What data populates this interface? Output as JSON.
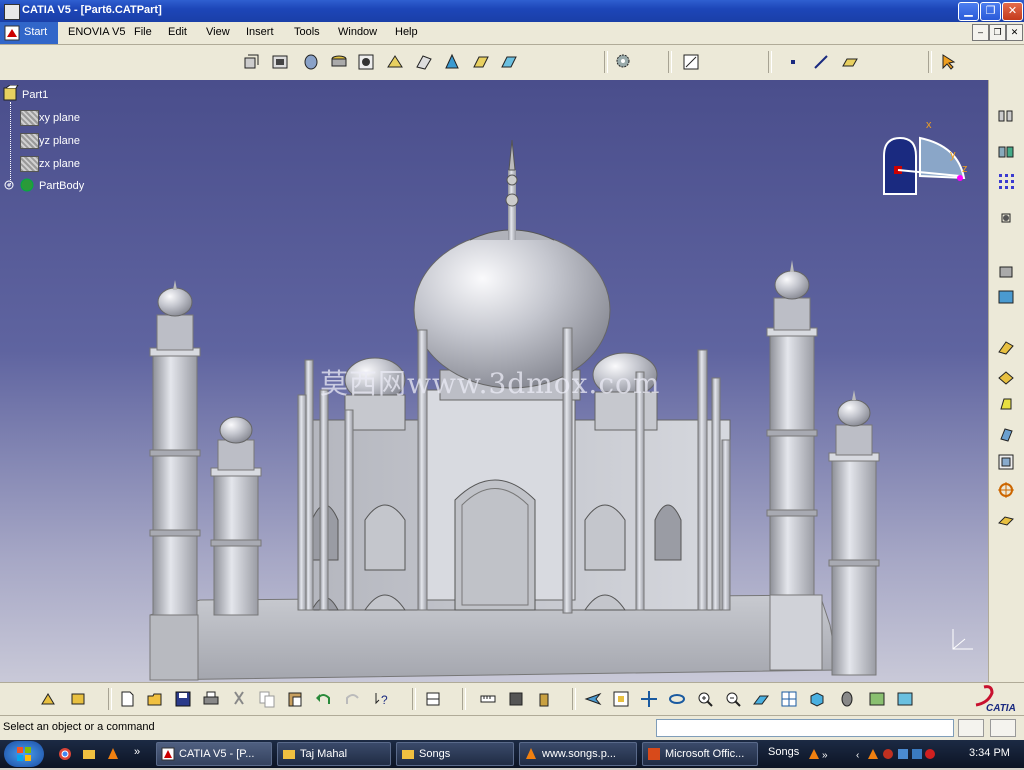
{
  "window": {
    "title": "CATIA V5 - [Part6.CATPart]",
    "controls": {
      "minimize": "▁",
      "restore": "❐",
      "close": "✕"
    }
  },
  "menu": {
    "start": "Start",
    "items": [
      "ENOVIA V5",
      "File",
      "Edit",
      "View",
      "Insert",
      "Tools",
      "Window",
      "Help"
    ],
    "mdi_controls": [
      "–",
      "❐",
      "✕"
    ]
  },
  "spec_tree": {
    "root": "Part1",
    "children": [
      "xy plane",
      "yz plane",
      "zx plane",
      "PartBody"
    ]
  },
  "compass_axes": {
    "x": "x",
    "y": "y",
    "z": "z"
  },
  "watermark": "莫西网www.3dmox.com",
  "status": {
    "prompt": "Select an object or a command",
    "command_input": ""
  },
  "taskbar": {
    "tasks": [
      {
        "label": "CATIA V5 - [P...",
        "icon": "catia-icon",
        "active": true
      },
      {
        "label": "Taj Mahal",
        "icon": "folder-icon",
        "active": false
      },
      {
        "label": "Songs",
        "icon": "folder-icon",
        "active": false
      },
      {
        "label": "www.songs.p...",
        "icon": "vlc-icon",
        "active": false
      },
      {
        "label": "Microsoft Offic...",
        "icon": "office-icon",
        "active": false
      }
    ],
    "tray_label": "Songs",
    "clock": "3:34 PM"
  },
  "brand": {
    "logo_text": "CATIA"
  },
  "colors": {
    "title_bar": "#1d46b8",
    "viewport_top": "#4a4e8c",
    "viewport_bottom": "#c9c9d8",
    "model": "#c7c9cf",
    "menu_bg": "#ece9d8",
    "taskbar": "#0c1424"
  }
}
